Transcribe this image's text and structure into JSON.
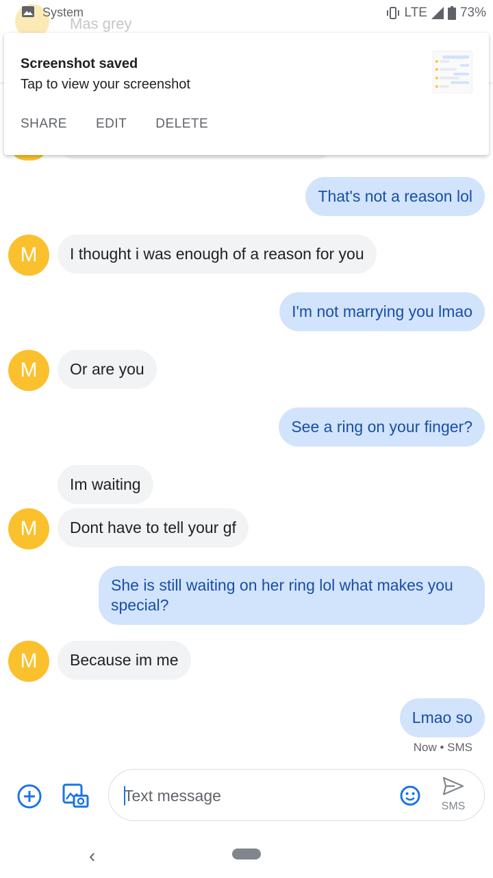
{
  "status_bar": {
    "app_name": "System",
    "network": "LTE",
    "battery": "73%"
  },
  "header": {
    "avatar_letter": "M",
    "contact_name": "Mas grey"
  },
  "notification": {
    "title": "Screenshot saved",
    "text": "Tap to view your screenshot",
    "actions": [
      "SHARE",
      "EDIT",
      "DELETE"
    ]
  },
  "messages": [
    {
      "dir": "out",
      "text": "That's not a reason lol"
    },
    {
      "dir": "in",
      "text": "I thought i was enough of a reason for you",
      "avatar": "M"
    },
    {
      "dir": "out",
      "text": "I'm not marrying you lmao"
    },
    {
      "dir": "in",
      "text": "Or are you",
      "avatar": "M"
    },
    {
      "dir": "out",
      "text": "See a ring on your finger?"
    },
    {
      "dir": "in",
      "text": "Im waiting"
    },
    {
      "dir": "in",
      "text": "Dont have to tell your gf",
      "avatar": "M"
    },
    {
      "dir": "out",
      "text": "She is still waiting on her ring lol what makes you special?"
    },
    {
      "dir": "in",
      "text": "Because im me",
      "avatar": "M"
    },
    {
      "dir": "out",
      "text": "Lmao so"
    }
  ],
  "last_meta": "Now • SMS",
  "compose": {
    "placeholder": "Text message",
    "send_label": "SMS"
  },
  "colors": {
    "avatar": "#fbc02d",
    "outgoing_bubble": "#d2e3fc",
    "outgoing_text": "#174ea6",
    "incoming_bubble": "#f1f3f4",
    "accent": "#1a73e8"
  }
}
